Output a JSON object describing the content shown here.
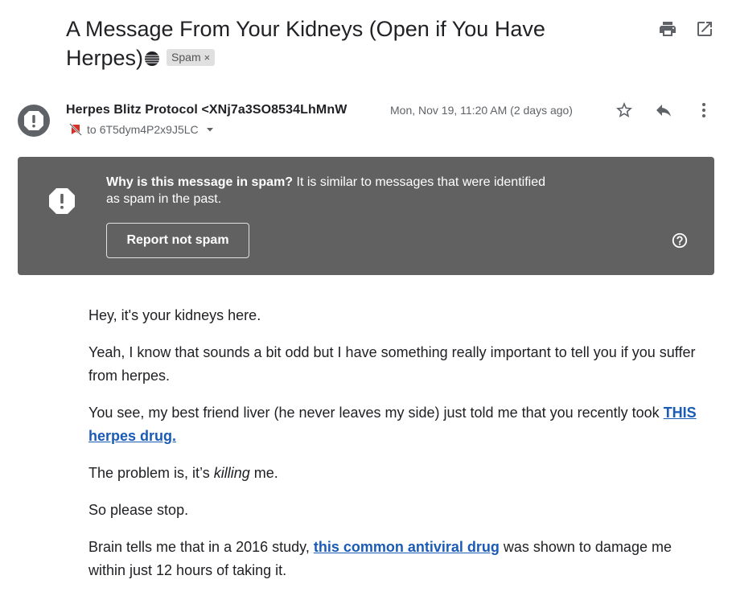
{
  "email": {
    "subject": "A Message From Your Kidneys (Open if You Have Herpes)",
    "label": "Spam",
    "label_remove": "×",
    "sender": "Herpes Blitz Protocol <XNj7a3SO8534LhMnW",
    "recipient_prefix": "to",
    "recipient": "6T5dym4P2x9J5LC",
    "date": "Mon, Nov 19, 11:20 AM (2 days ago)"
  },
  "banner": {
    "question": "Why is this message in spam?",
    "explanation": " It is similar to messages that were identified as spam in the past.",
    "button": "Report not spam"
  },
  "body": {
    "p1": "Hey, it's your kidneys here.",
    "p2": "Yeah, I know that sounds a bit odd but I have something really important to tell you if you suffer from herpes.",
    "p3_before": "You see, my best friend liver (he never leaves my side) just told me that you recently took ",
    "p3_link": "THIS herpes drug.",
    "p4_before": "The problem is, it’s ",
    "p4_em": "killing",
    "p4_after": " me.",
    "p5": "So please stop.",
    "p6_before": "Brain tells me that in a 2016 study, ",
    "p6_link": "this common antiviral drug",
    "p6_after": " was shown to damage me within just 12 hours of taking it."
  },
  "colors": {
    "banner_bg": "#616161",
    "link": "#1a5bb5",
    "icon_gray": "#5f6368",
    "spam_red": "#d93025"
  },
  "icons": [
    "print-icon",
    "open-in-new-icon",
    "spam-warning-icon",
    "star-icon",
    "reply-icon",
    "more-vert-icon",
    "help-icon",
    "chevron-down-icon"
  ]
}
